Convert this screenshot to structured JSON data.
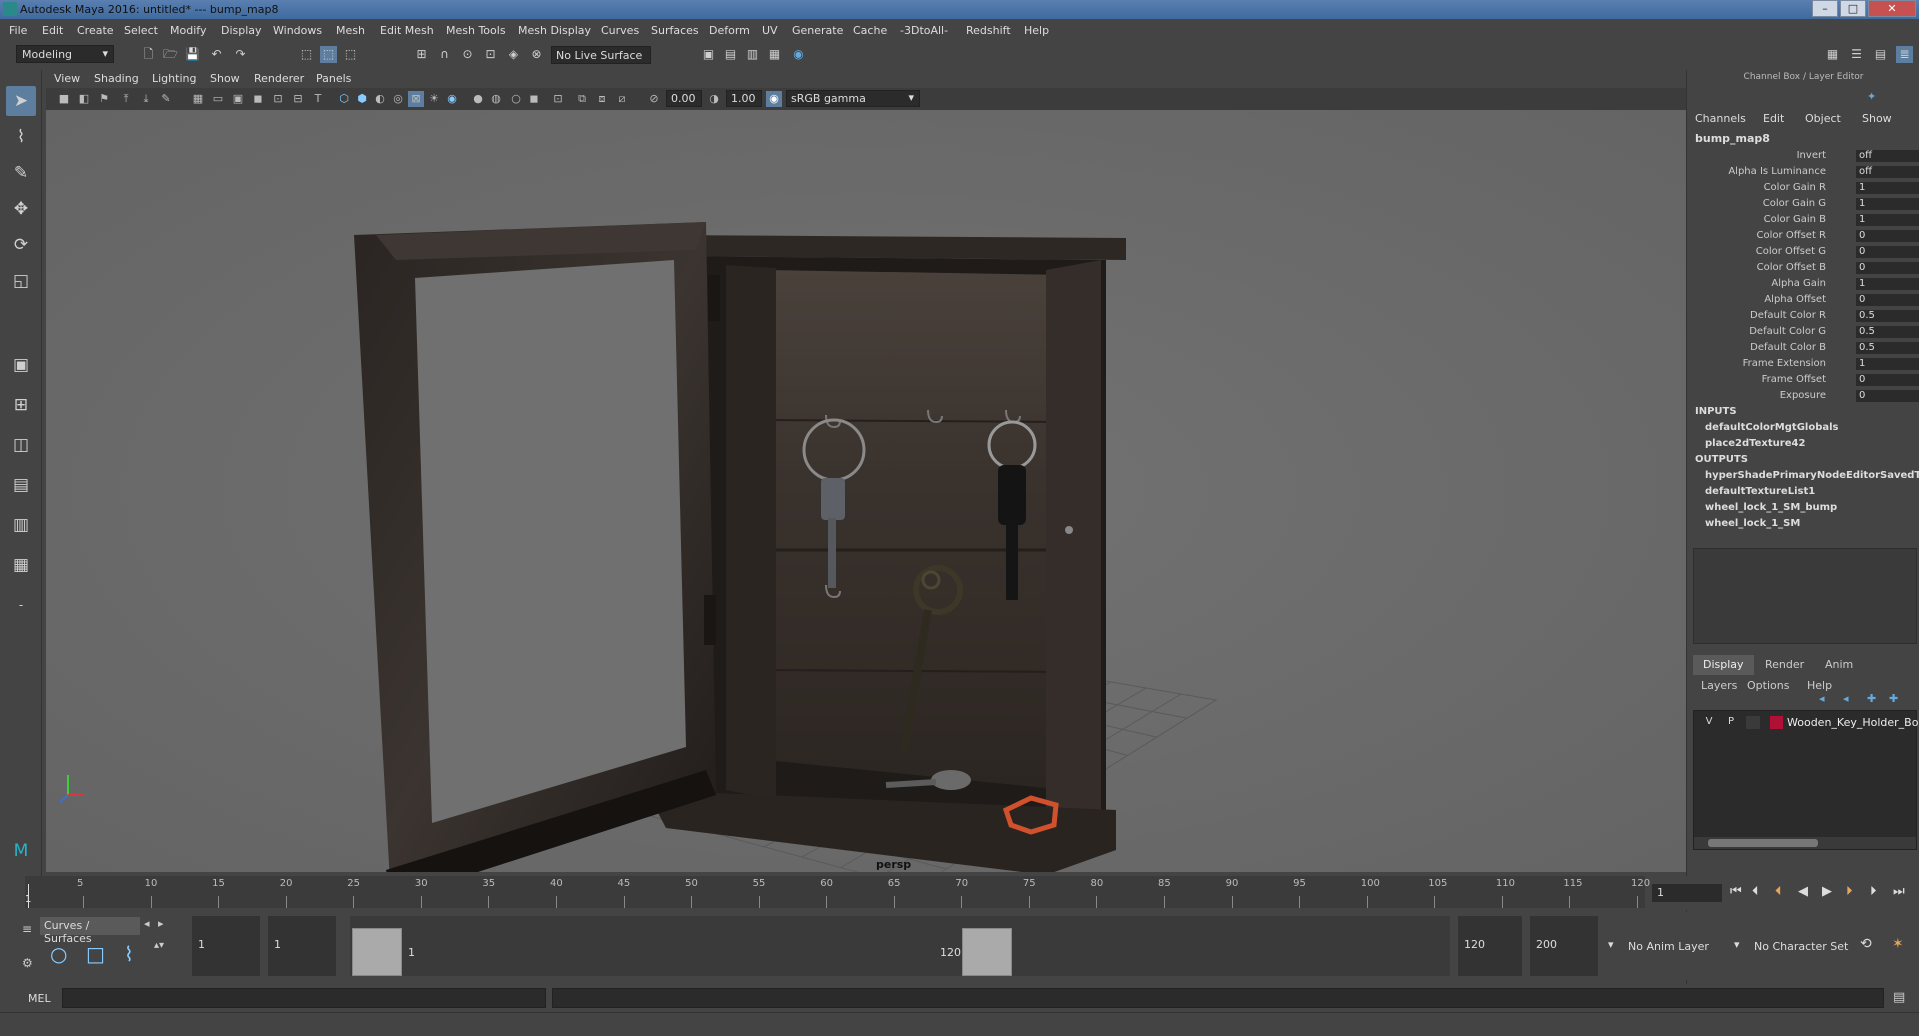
{
  "window": {
    "title": "Autodesk Maya 2016: untitled*   ---   bump_map8",
    "minimize": "–",
    "maximize": "□",
    "close": "✕"
  },
  "menubar": [
    "File",
    "Edit",
    "Create",
    "Select",
    "Modify",
    "Display",
    "Windows",
    "Mesh",
    "Edit Mesh",
    "Mesh Tools",
    "Mesh Display",
    "Curves",
    "Surfaces",
    "Deform",
    "UV",
    "Generate",
    "Cache",
    "-3DtoAll-",
    "Redshift",
    "Help"
  ],
  "toolbar": {
    "mode": "Modeling",
    "live_surface": "No Live Surface"
  },
  "panel_menu": [
    "View",
    "Shading",
    "Lighting",
    "Show",
    "Renderer",
    "Panels"
  ],
  "panel_toolbar": {
    "exposure": "0.00",
    "gamma": "1.00",
    "color_space": "sRGB gamma"
  },
  "viewport": {
    "camera_label": "persp"
  },
  "channel_box": {
    "header": "Channel Box / Layer Editor",
    "tabs": [
      "Channels",
      "Edit",
      "Object",
      "Show"
    ],
    "node": "bump_map8",
    "attributes": [
      {
        "label": "Invert",
        "value": "off"
      },
      {
        "label": "Alpha Is Luminance",
        "value": "off"
      },
      {
        "label": "Color Gain R",
        "value": "1"
      },
      {
        "label": "Color Gain G",
        "value": "1"
      },
      {
        "label": "Color Gain B",
        "value": "1"
      },
      {
        "label": "Color Offset R",
        "value": "0"
      },
      {
        "label": "Color Offset G",
        "value": "0"
      },
      {
        "label": "Color Offset B",
        "value": "0"
      },
      {
        "label": "Alpha Gain",
        "value": "1"
      },
      {
        "label": "Alpha Offset",
        "value": "0"
      },
      {
        "label": "Default Color R",
        "value": "0.5"
      },
      {
        "label": "Default Color G",
        "value": "0.5"
      },
      {
        "label": "Default Color B",
        "value": "0.5"
      },
      {
        "label": "Frame Extension",
        "value": "1"
      },
      {
        "label": "Frame Offset",
        "value": "0"
      },
      {
        "label": "Exposure",
        "value": "0"
      }
    ],
    "inputs_label": "INPUTS",
    "inputs": [
      "defaultColorMgtGlobals",
      "place2dTexture42"
    ],
    "outputs_label": "OUTPUTS",
    "outputs": [
      "hyperShadePrimaryNodeEditorSavedT...",
      "defaultTextureList1",
      "wheel_lock_1_SM_bump",
      "wheel_lock_1_SM"
    ]
  },
  "layer_editor": {
    "tabs": [
      "Display",
      "Render",
      "Anim"
    ],
    "menu": [
      "Layers",
      "Options",
      "Help"
    ],
    "layer": {
      "v": "V",
      "p": "P",
      "name": "Wooden_Key_Holder_Bo"
    }
  },
  "time_slider": {
    "ticks": [
      "5",
      "10",
      "15",
      "20",
      "25",
      "30",
      "35",
      "40",
      "45",
      "50",
      "55",
      "60",
      "65",
      "70",
      "75",
      "80",
      "85",
      "90",
      "95",
      "100",
      "105",
      "110",
      "115",
      "120"
    ],
    "start_tick": "1",
    "current_frame": "1"
  },
  "range_slider": {
    "shelf": "Curves / Surfaces",
    "start": "1",
    "playback_start": "1",
    "range_start": "1",
    "range_end": "120",
    "playback_end": "120",
    "end": "200",
    "anim_layer": "No Anim Layer",
    "character_set": "No Character Set"
  },
  "command_line": {
    "label": "MEL"
  }
}
